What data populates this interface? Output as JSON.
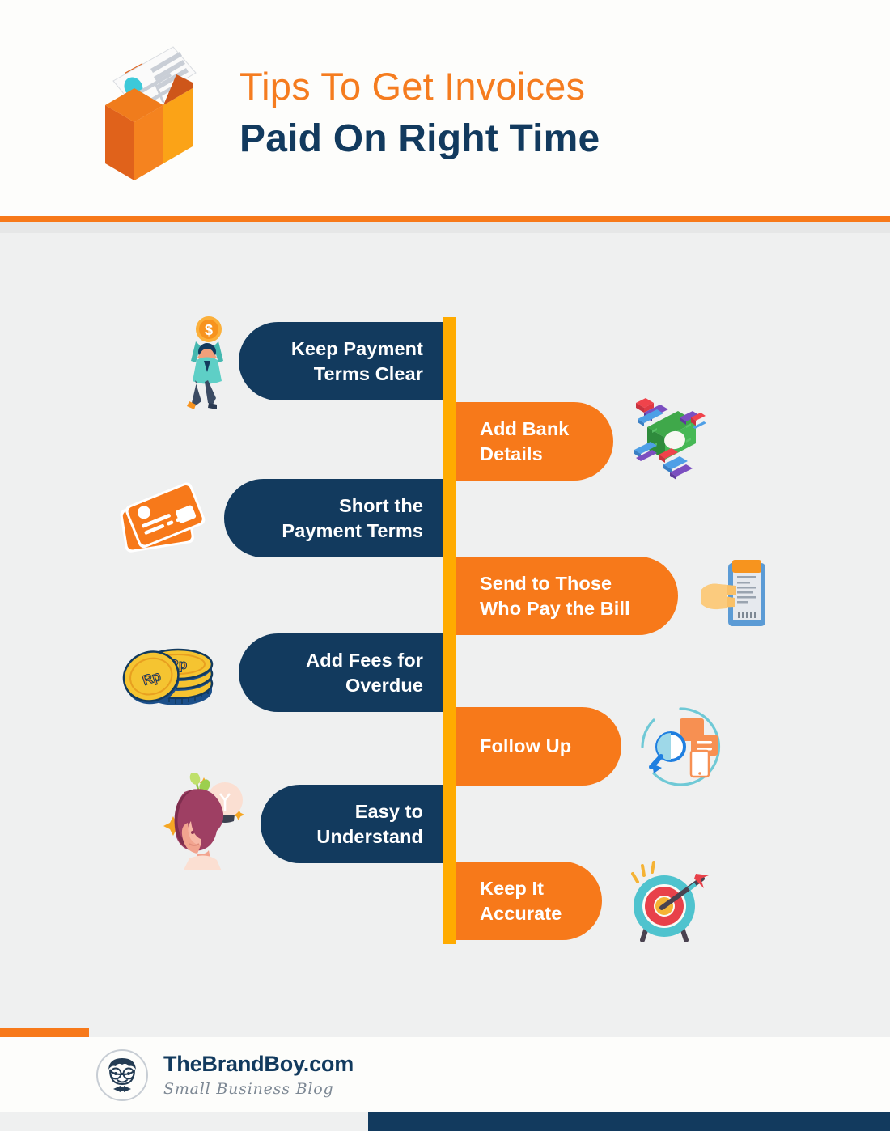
{
  "header": {
    "title_line1": "Tips To Get Invoices",
    "title_line2": "Paid On Right Time",
    "icon": "open-envelope-with-document-icon"
  },
  "colors": {
    "orange": "#F7791A",
    "navy": "#123A5E",
    "amber_spine": "#FFAB00",
    "panel_gray": "#EFF0F0",
    "title_orange": "#F57C1F",
    "white": "#FFFFFF"
  },
  "spine": {
    "name": "vertical-timeline-spine",
    "color": "#FFAB00"
  },
  "tips": [
    {
      "index": 1,
      "side": "left",
      "label_line1": "Keep Payment",
      "label_line2": "Terms Clear",
      "style": "navy",
      "icon": "person-holding-dollar-coin-icon"
    },
    {
      "index": 2,
      "side": "right",
      "label_line1": "Add Bank",
      "label_line2": "Details",
      "style": "orange",
      "icon": "banknote-with-cards-icon"
    },
    {
      "index": 3,
      "side": "left",
      "label_line1": "Short the",
      "label_line2": "Payment Terms",
      "style": "navy",
      "icon": "credit-cards-icon"
    },
    {
      "index": 4,
      "side": "right",
      "label_line1": "Send to Those",
      "label_line2": "Who Pay the Bill",
      "style": "orange",
      "icon": "clipboard-invoice-with-hand-icon"
    },
    {
      "index": 5,
      "side": "left",
      "label_line1": "Add Fees for",
      "label_line2": "Overdue",
      "style": "navy",
      "icon": "stacked-gold-coins-icon"
    },
    {
      "index": 6,
      "side": "right",
      "label_line1": "Follow Up",
      "label_line2": "",
      "style": "orange",
      "icon": "magnifier-documents-refresh-icon"
    },
    {
      "index": 7,
      "side": "left",
      "label_line1": "Easy to",
      "label_line2": "Understand",
      "style": "navy",
      "icon": "woman-head-with-lightbulb-idea-icon"
    },
    {
      "index": 8,
      "side": "right",
      "label_line1": "Keep It",
      "label_line2": "Accurate",
      "style": "orange",
      "icon": "target-with-arrow-icon"
    }
  ],
  "footer": {
    "brand_name": "TheBrandBoy.com",
    "brand_tagline": "Small Business Blog",
    "logo": "boy-face-with-glasses-and-bowtie-icon"
  }
}
